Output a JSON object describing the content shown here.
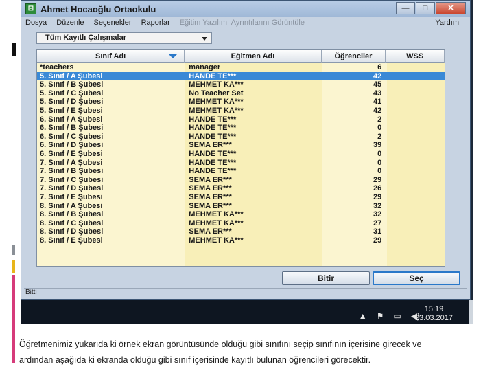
{
  "window": {
    "title": "Ahmet Hocaoğlu Ortaokulu",
    "app_icon": "app-icon",
    "minimize": "—",
    "maximize": "□",
    "close": "✕"
  },
  "menu": {
    "items": [
      "Dosya",
      "Düzenle",
      "Seçenekler",
      "Raporlar"
    ],
    "disabled_item": "Eğitim Yazılımı Ayrıntılarını Görüntüle",
    "help": "Yardım"
  },
  "filter": {
    "selected": "Tüm Kayıtlı Çalışmalar"
  },
  "grid": {
    "columns": [
      "Sınıf Adı",
      "Eğitmen Adı",
      "Öğrenciler",
      "WSS"
    ],
    "rows": [
      [
        "*teachers",
        "manager",
        "6",
        ""
      ],
      [
        "5. Sınıf / A Şubesi",
        "HANDE TE***",
        "42",
        ""
      ],
      [
        "5. Sınıf / B Şubesi",
        "MEHMET KA***",
        "45",
        ""
      ],
      [
        "5. Sınıf / C Şubesi",
        "No Teacher Set",
        "43",
        ""
      ],
      [
        "5. Sınıf / D Şubesi",
        "MEHMET KA***",
        "41",
        ""
      ],
      [
        "5. Sınıf / E Şubesi",
        "MEHMET KA***",
        "42",
        ""
      ],
      [
        "6. Sınıf / A Şubesi",
        "HANDE TE***",
        "2",
        ""
      ],
      [
        "6. Sınıf / B Şubesi",
        "HANDE TE***",
        "0",
        ""
      ],
      [
        "6. Sınıf / C Şubesi",
        "HANDE TE***",
        "2",
        ""
      ],
      [
        "6. Sınıf / D Şubesi",
        "SEMA ER***",
        "39",
        ""
      ],
      [
        "6. Sınıf / E Şubesi",
        "HANDE TE***",
        "0",
        ""
      ],
      [
        "7. Sınıf / A Şubesi",
        "HANDE TE***",
        "0",
        ""
      ],
      [
        "7. Sınıf / B Şubesi",
        "HANDE TE***",
        "0",
        ""
      ],
      [
        "7. Sınıf / C Şubesi",
        "SEMA ER***",
        "29",
        ""
      ],
      [
        "7. Sınıf / D Şubesi",
        "SEMA ER***",
        "26",
        ""
      ],
      [
        "7. Sınıf / E Şubesi",
        "SEMA ER***",
        "29",
        ""
      ],
      [
        "8. Sınıf / A Şubesi",
        "SEMA ER***",
        "32",
        ""
      ],
      [
        "8. Sınıf / B Şubesi",
        "MEHMET KA***",
        "32",
        ""
      ],
      [
        "8. Sınıf / C Şubesi",
        "MEHMET KA***",
        "27",
        ""
      ],
      [
        "8. Sınıf / D Şubesi",
        "SEMA ER***",
        "31",
        ""
      ],
      [
        "8. Sınıf / E Şubesi",
        "MEHMET KA***",
        "29",
        ""
      ]
    ],
    "selected_row": 1
  },
  "buttons": {
    "finish": "Bitir",
    "select": "Seç"
  },
  "status": "Bitti",
  "taskbar": {
    "icons": [
      "▲",
      "⚑",
      "▭",
      "◀)"
    ],
    "time": "15:19",
    "date": "23.03.2017"
  },
  "caption": {
    "line1": "Öğretmenimiz yukarıda ki örnek ekran görüntüsünde olduğu gibi sınıfını seçip sınıfının içerisine girecek ve",
    "line2": "ardından aşağıda ki ekranda olduğu gibi sınıf içerisinde kayıtlı bulunan öğrencileri görecektir."
  }
}
